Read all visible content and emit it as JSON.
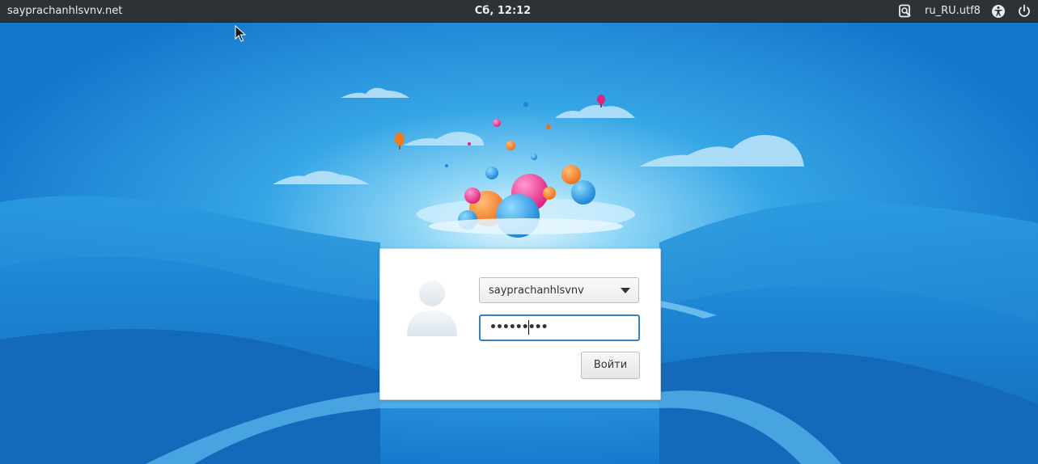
{
  "top_panel": {
    "hostname": "sayprachanhlsvnv.net",
    "clock": "Сб, 12:12",
    "locale": "ru_RU.utf8",
    "icons": [
      "keyboard-layout-icon",
      "accessibility-icon",
      "power-icon"
    ]
  },
  "login": {
    "username": "sayprachanhlsvnv",
    "password_mask": "•••••••••",
    "login_button_label": "Войти"
  },
  "colors": {
    "panel_bg": "#2d3236",
    "sky": "#1b86d6",
    "focus_border": "#3584c7"
  }
}
